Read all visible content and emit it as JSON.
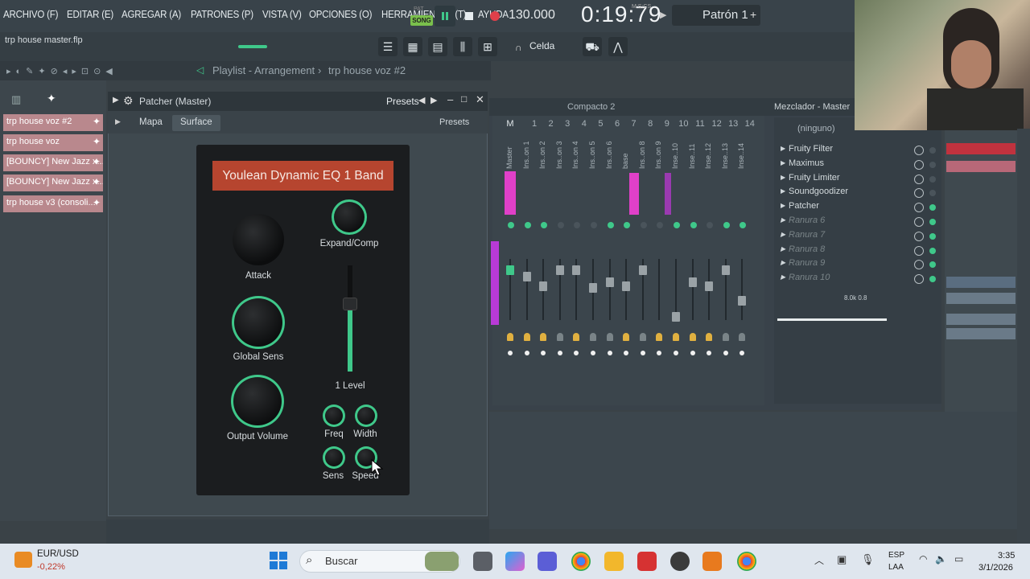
{
  "menu": [
    "ARCHIVO (F)",
    "EDITAR (E)",
    "AGREGAR (A)",
    "PATRONES (P)",
    "VISTA (V)",
    "OPCIONES (O)",
    "HERRAMIENTAS (T)",
    "AYUDA"
  ],
  "transport": {
    "song_label": "SONG",
    "pat_label": "PAT",
    "tempo": "130.000",
    "time": "0:19:79",
    "time_unit": "M:S:CS",
    "pattern": "Patrón 1"
  },
  "file_hint": "trp house master.flp",
  "snap": "Celda",
  "playlist": {
    "title": "Playlist - Arrangement",
    "separator": "›",
    "pattern": "trp house voz #2"
  },
  "tracks": [
    "trp house voz #2",
    "trp house voz",
    "[BOUNCY] New Jazz x...",
    "[BOUNCY] New Jazz x...",
    "trp house v3 (consoli..."
  ],
  "patcher": {
    "title": "Patcher (Master)",
    "presets": "Presets",
    "tabs": [
      "Mapa",
      "Surface"
    ],
    "inner_presets": "Presets",
    "plugin_title": "Youlean Dynamic EQ 1 Band",
    "knobs": {
      "attack": "Attack",
      "global_sens": "Global Sens",
      "output_volume": "Output Volume",
      "expand_comp": "Expand/Comp",
      "level": "1 Level",
      "freq": "Freq",
      "width": "Width",
      "sens": "Sens",
      "speed": "Speed"
    }
  },
  "mixer": {
    "compacto": "Compacto 2",
    "title": "Mezclador - Master",
    "master_label": "M",
    "numbers": [
      "1",
      "2",
      "3",
      "4",
      "5",
      "6",
      "7",
      "8",
      "9",
      "10",
      "11",
      "12",
      "13",
      "14"
    ],
    "names": [
      "Master",
      "Ins..on 1",
      "Ins..on 2",
      "Ins..on 3",
      "Ins..on 4",
      "Ins..on 5",
      "Ins..on 6",
      "base",
      "Ins..on 8",
      "Ins..on 9",
      "Inse..10",
      "Inse..11",
      "Inse..12",
      "Inse..13",
      "Inse..14"
    ],
    "slot_header": "(ninguno)",
    "effects": [
      "Fruity Filter",
      "Maximus",
      "Fruity Limiter",
      "Soundgoodizer",
      "Patcher",
      "Ranura 6",
      "Ranura 7",
      "Ranura 8",
      "Ranura 9",
      "Ranura 10"
    ],
    "rate": "8.0k 0.8"
  },
  "taskbar": {
    "ticker": "EUR/USD",
    "ticker_change": "-0,22%",
    "search": "Buscar",
    "lang1": "ESP",
    "lang2": "LAA",
    "time": "3:35",
    "date": "3/1/2026"
  },
  "colors": {
    "accent": "#3fc88a",
    "plugin_title_bg": "#b6452f",
    "track_bg": "#b9888d",
    "pink": "#e040c8"
  }
}
